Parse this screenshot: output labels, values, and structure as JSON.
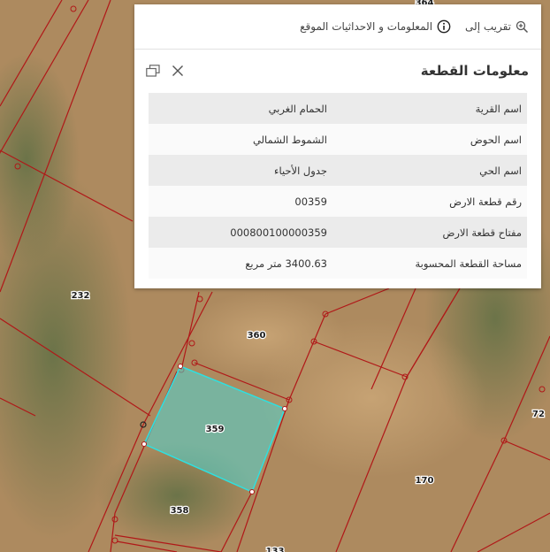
{
  "map": {
    "parcel_labels": [
      "232",
      "360",
      "359",
      "358",
      "72",
      "170",
      "133",
      "364"
    ],
    "selected_parcel_color": "#4fd6d2",
    "boundary_color": "#b01818",
    "selected_outline_color": "#2ee0e0"
  },
  "popup": {
    "actions": {
      "zoom_to": "تقريب إلى",
      "info_coordinates": "المعلومات و الاحداثيات الموقع"
    },
    "title": "معلومات القطعة",
    "rows": [
      {
        "key": "اسم القرية",
        "value": "الحمام الغربي"
      },
      {
        "key": "اسم الحوض",
        "value": "الشموط الشمالي"
      },
      {
        "key": "اسم الحي",
        "value": "جدول الأحياء"
      },
      {
        "key": "رقم قطعة الارض",
        "value": "00359"
      },
      {
        "key": "مفتاح قطعة الارض",
        "value": "000800100000359"
      },
      {
        "key": "مساحة القطعة المحسوبة",
        "value": "3400.63 متر مربع"
      }
    ]
  }
}
